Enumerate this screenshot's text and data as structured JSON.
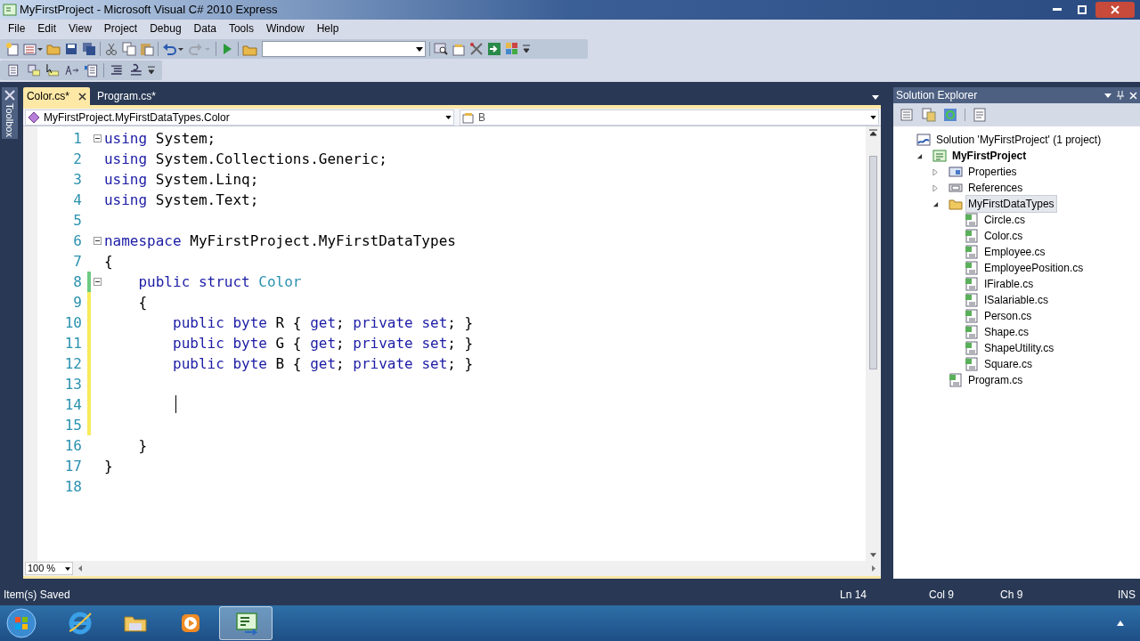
{
  "window": {
    "title": "MyFirstProject - Microsoft Visual C# 2010 Express"
  },
  "menu": [
    "File",
    "Edit",
    "View",
    "Project",
    "Debug",
    "Data",
    "Tools",
    "Window",
    "Help"
  ],
  "toolbox_tab": {
    "label": "Toolbox"
  },
  "tabs": [
    {
      "label": "Color.cs*",
      "selected": true
    },
    {
      "label": "Program.cs*",
      "selected": false
    }
  ],
  "nav": {
    "type_dropdown": "MyFirstProject.MyFirstDataTypes.Color",
    "member_dropdown": "B"
  },
  "code_lines": [
    {
      "number": "1",
      "fold": true,
      "tokens": [
        {
          "kind": "keyword",
          "text": "using"
        },
        {
          "kind": "plain",
          "text": " System;"
        }
      ]
    },
    {
      "number": "2",
      "tokens": [
        {
          "kind": "keyword",
          "text": "using"
        },
        {
          "kind": "plain",
          "text": " System.Collections.Generic;"
        }
      ]
    },
    {
      "number": "3",
      "tokens": [
        {
          "kind": "keyword",
          "text": "using"
        },
        {
          "kind": "plain",
          "text": " System.Linq;"
        }
      ]
    },
    {
      "number": "4",
      "tokens": [
        {
          "kind": "keyword",
          "text": "using"
        },
        {
          "kind": "plain",
          "text": " System.Text;"
        }
      ]
    },
    {
      "number": "5"
    },
    {
      "number": "6",
      "fold": true,
      "tokens": [
        {
          "kind": "keyword",
          "text": "namespace"
        },
        {
          "kind": "plain",
          "text": " MyFirstProject.MyFirstDataTypes"
        }
      ]
    },
    {
      "number": "7",
      "tokens": [
        {
          "kind": "plain",
          "text": "{"
        }
      ]
    },
    {
      "number": "8",
      "fold": true,
      "changed": true,
      "saved": true,
      "tokens": [
        {
          "kind": "keyword",
          "text": "    public struct "
        },
        {
          "kind": "type",
          "text": "Color"
        }
      ]
    },
    {
      "number": "9",
      "changed": true,
      "saved": false,
      "tokens": [
        {
          "kind": "plain",
          "text": "    {"
        }
      ]
    },
    {
      "number": "10",
      "changed": true,
      "saved": false,
      "tokens": [
        {
          "kind": "keyword",
          "text": "        public byte"
        },
        {
          "kind": "plain",
          "text": " R { "
        },
        {
          "kind": "keyword",
          "text": "get"
        },
        {
          "kind": "plain",
          "text": "; "
        },
        {
          "kind": "keyword",
          "text": "private set"
        },
        {
          "kind": "plain",
          "text": "; }"
        }
      ]
    },
    {
      "number": "11",
      "changed": true,
      "saved": false,
      "tokens": [
        {
          "kind": "keyword",
          "text": "        public byte"
        },
        {
          "kind": "plain",
          "text": " G { "
        },
        {
          "kind": "keyword",
          "text": "get"
        },
        {
          "kind": "plain",
          "text": "; "
        },
        {
          "kind": "keyword",
          "text": "private set"
        },
        {
          "kind": "plain",
          "text": "; }"
        }
      ]
    },
    {
      "number": "12",
      "changed": true,
      "saved": false,
      "tokens": [
        {
          "kind": "keyword",
          "text": "        public byte"
        },
        {
          "kind": "plain",
          "text": " B { "
        },
        {
          "kind": "keyword",
          "text": "get"
        },
        {
          "kind": "plain",
          "text": "; "
        },
        {
          "kind": "keyword",
          "text": "private set"
        },
        {
          "kind": "plain",
          "text": "; }"
        }
      ]
    },
    {
      "number": "13",
      "changed": true,
      "saved": false
    },
    {
      "number": "14",
      "changed": true,
      "saved": false,
      "caret": true
    },
    {
      "number": "15",
      "changed": true,
      "saved": false
    },
    {
      "number": "16",
      "tokens": [
        {
          "kind": "plain",
          "text": "    }"
        }
      ]
    },
    {
      "number": "17",
      "tokens": [
        {
          "kind": "plain",
          "text": "}"
        }
      ]
    },
    {
      "number": "18"
    }
  ],
  "zoom": "100 %",
  "solution_explorer": {
    "title": "Solution Explorer",
    "tree": [
      {
        "kind": "solution",
        "label": "Solution 'MyFirstProject' (1 project)",
        "selected": false,
        "children": [
          {
            "kind": "project",
            "label": "MyFirstProject",
            "expanded": true,
            "selected": false,
            "children": [
              {
                "kind": "properties",
                "label": "Properties",
                "expanded": false,
                "selected": false
              },
              {
                "kind": "references",
                "label": "References",
                "expanded": false,
                "selected": false
              },
              {
                "kind": "folder",
                "label": "MyFirstDataTypes",
                "expanded": true,
                "selected": true,
                "children": [
                  {
                    "kind": "file",
                    "label": "Circle.cs",
                    "selected": false
                  },
                  {
                    "kind": "file",
                    "label": "Color.cs",
                    "selected": false
                  },
                  {
                    "kind": "file",
                    "label": "Employee.cs",
                    "selected": false
                  },
                  {
                    "kind": "file",
                    "label": "EmployeePosition.cs",
                    "selected": false
                  },
                  {
                    "kind": "file",
                    "label": "IFirable.cs",
                    "selected": false
                  },
                  {
                    "kind": "file",
                    "label": "ISalariable.cs",
                    "selected": false
                  },
                  {
                    "kind": "file",
                    "label": "Person.cs",
                    "selected": false
                  },
                  {
                    "kind": "file",
                    "label": "Shape.cs",
                    "selected": false
                  },
                  {
                    "kind": "file",
                    "label": "ShapeUtility.cs",
                    "selected": false
                  },
                  {
                    "kind": "file",
                    "label": "Square.cs",
                    "selected": false
                  }
                ]
              },
              {
                "kind": "file",
                "label": "Program.cs",
                "selected": false
              }
            ]
          }
        ]
      }
    ]
  },
  "status_bar": {
    "message": "Item(s) Saved",
    "line": "Ln 14",
    "column": "Col 9",
    "char": "Ch 9",
    "mode": "INS"
  },
  "taskbar": [
    {
      "kind": "ie",
      "selected": false
    },
    {
      "kind": "explorer",
      "selected": false
    },
    {
      "kind": "media",
      "selected": false
    },
    {
      "kind": "csharp",
      "selected": true
    }
  ]
}
